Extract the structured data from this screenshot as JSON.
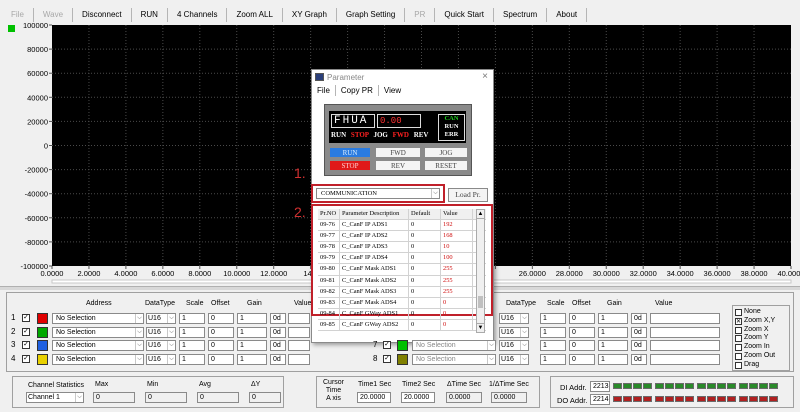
{
  "menu": [
    {
      "label": "File",
      "disabled": true
    },
    {
      "label": "Wave",
      "disabled": true
    },
    {
      "label": "Disconnect",
      "disabled": false
    },
    {
      "label": "RUN",
      "disabled": false
    },
    {
      "label": "4 Channels",
      "disabled": false
    },
    {
      "label": "Zoom ALL",
      "disabled": false
    },
    {
      "label": "XY Graph",
      "disabled": false
    },
    {
      "label": "Graph Setting",
      "disabled": false
    },
    {
      "label": "PR",
      "disabled": true
    },
    {
      "label": "Quick Start",
      "disabled": false
    },
    {
      "label": "Spectrum",
      "disabled": false
    },
    {
      "label": "About",
      "disabled": false
    }
  ],
  "chart_data": {
    "type": "line",
    "y_ticks": [
      "100000",
      "80000",
      "60000",
      "40000",
      "20000",
      "0",
      "-20000",
      "-40000",
      "-60000",
      "-80000",
      "-100000"
    ],
    "x_ticks": [
      "0.0000",
      "2.0000",
      "4.0000",
      "6.0000",
      "8.0000",
      "10.0000",
      "12.0000",
      "14.0",
      "",
      "",
      "",
      "",
      "",
      "26.0000",
      "28.0000",
      "30.0000",
      "32.0000",
      "34.0000",
      "36.0000",
      "38.0000",
      "40.0000"
    ],
    "ylim": [
      -100000,
      100000
    ],
    "xlim": [
      0,
      40
    ],
    "background": "#000000",
    "grid_color": "#4a4a4a",
    "series": []
  },
  "channels_panel": {
    "headers": {
      "address": "Address",
      "datatype": "DataType",
      "scale": "Scale",
      "offset": "Offset",
      "gain": "Gain",
      "value": "Value"
    },
    "left_rows": [
      {
        "num": "1",
        "color": "#e00000",
        "address": "No Selection",
        "datatype": "U16",
        "scale": "1",
        "offset": "0",
        "gain": "1",
        "value": "0d"
      },
      {
        "num": "2",
        "color": "#00a800",
        "address": "No Selection",
        "datatype": "U16",
        "scale": "1",
        "offset": "0",
        "gain": "1",
        "value": "0d"
      },
      {
        "num": "3",
        "color": "#2060e0",
        "address": "No Selection",
        "datatype": "U16",
        "scale": "1",
        "offset": "0",
        "gain": "1",
        "value": "0d"
      },
      {
        "num": "4",
        "color": "#e8d000",
        "address": "No Selection",
        "datatype": "U16",
        "scale": "1",
        "offset": "0",
        "gain": "1",
        "value": "0d"
      }
    ],
    "right_rows": [
      {
        "num": "7",
        "color": "#00c000",
        "address": "No Selection",
        "datatype": "U16",
        "scale": "1",
        "offset": "0",
        "gain": "1",
        "value": "0d"
      },
      {
        "num": "8",
        "color": "#808000",
        "address": "No Selection",
        "datatype": "U16",
        "scale": "1",
        "offset": "0",
        "gain": "1",
        "value": "0d"
      }
    ],
    "right_extra_values": [
      "0d",
      "0d"
    ]
  },
  "zoom_options": [
    {
      "label": "None",
      "checked": false
    },
    {
      "label": "Zoom X,Y",
      "checked": true
    },
    {
      "label": "Zoom X",
      "checked": false
    },
    {
      "label": "Zoom Y",
      "checked": false
    },
    {
      "label": "Zoom In",
      "checked": false
    },
    {
      "label": "Zoom Out",
      "checked": false
    },
    {
      "label": "Drag",
      "checked": false
    }
  ],
  "statistics": {
    "label": "Channel Statistics",
    "channel": "Channel 1",
    "max_label": "Max",
    "max": "0",
    "min_label": "Min",
    "min": "0",
    "avg_label": "Avg",
    "avg": "0",
    "dy_label": "ΔY",
    "dy": "0"
  },
  "cursor": {
    "label_lines": [
      "Cursor",
      "Time",
      "A xis"
    ],
    "time1_label": "Time1 Sec",
    "time1": "20.0000",
    "time2_label": "Time2 Sec",
    "time2": "20.0000",
    "dtime_label": "ΔTime Sec",
    "dtime": "0.0000",
    "inv_label": "1/ΔTime Sec",
    "inv": "0.0000"
  },
  "io": {
    "di_label": "DI Addr.",
    "di_addr": "2213",
    "do_label": "DO Addr.",
    "do_addr": "2214"
  },
  "dialog": {
    "title": "Parameter",
    "menu": [
      "File",
      "Copy PR",
      "View"
    ],
    "logo": "FHUA",
    "display_value": "0.00",
    "can_label": "CAN",
    "can_status": [
      "RUN",
      "ERR"
    ],
    "status_row": [
      "RUN",
      "STOP",
      "JOG",
      "FWD",
      "REV"
    ],
    "buttons": [
      "RUN",
      "FWD",
      "JOG",
      "STOP",
      "REV",
      "RESET"
    ],
    "group_select": "COMMUNICATION",
    "load_button": "Load Pr.",
    "markers": [
      "1.",
      "2."
    ],
    "table_headers": [
      "Pr.NO",
      "Parameter Description",
      "Default",
      "Value"
    ],
    "rows": [
      {
        "no": "09-76",
        "desc": "C_CanF IP ADS1",
        "def": "0",
        "val": "192"
      },
      {
        "no": "09-77",
        "desc": "C_CanF IP ADS2",
        "def": "0",
        "val": "168"
      },
      {
        "no": "09-78",
        "desc": "C_CanF IP ADS3",
        "def": "0",
        "val": "10"
      },
      {
        "no": "09-79",
        "desc": "C_CanF IP ADS4",
        "def": "0",
        "val": "100"
      },
      {
        "no": "09-80",
        "desc": "C_CanF Mask ADS1",
        "def": "0",
        "val": "255"
      },
      {
        "no": "09-81",
        "desc": "C_CanF Mask ADS2",
        "def": "0",
        "val": "255"
      },
      {
        "no": "09-82",
        "desc": "C_CanF Mask ADS3",
        "def": "0",
        "val": "255"
      },
      {
        "no": "09-83",
        "desc": "C_CanF Mask ADS4",
        "def": "0",
        "val": "0"
      },
      {
        "no": "09-84",
        "desc": "C_CanF GWay ADS1",
        "def": "0",
        "val": "0"
      },
      {
        "no": "09-85",
        "desc": "C_CanF GWay ADS2",
        "def": "0",
        "val": "0"
      }
    ]
  }
}
